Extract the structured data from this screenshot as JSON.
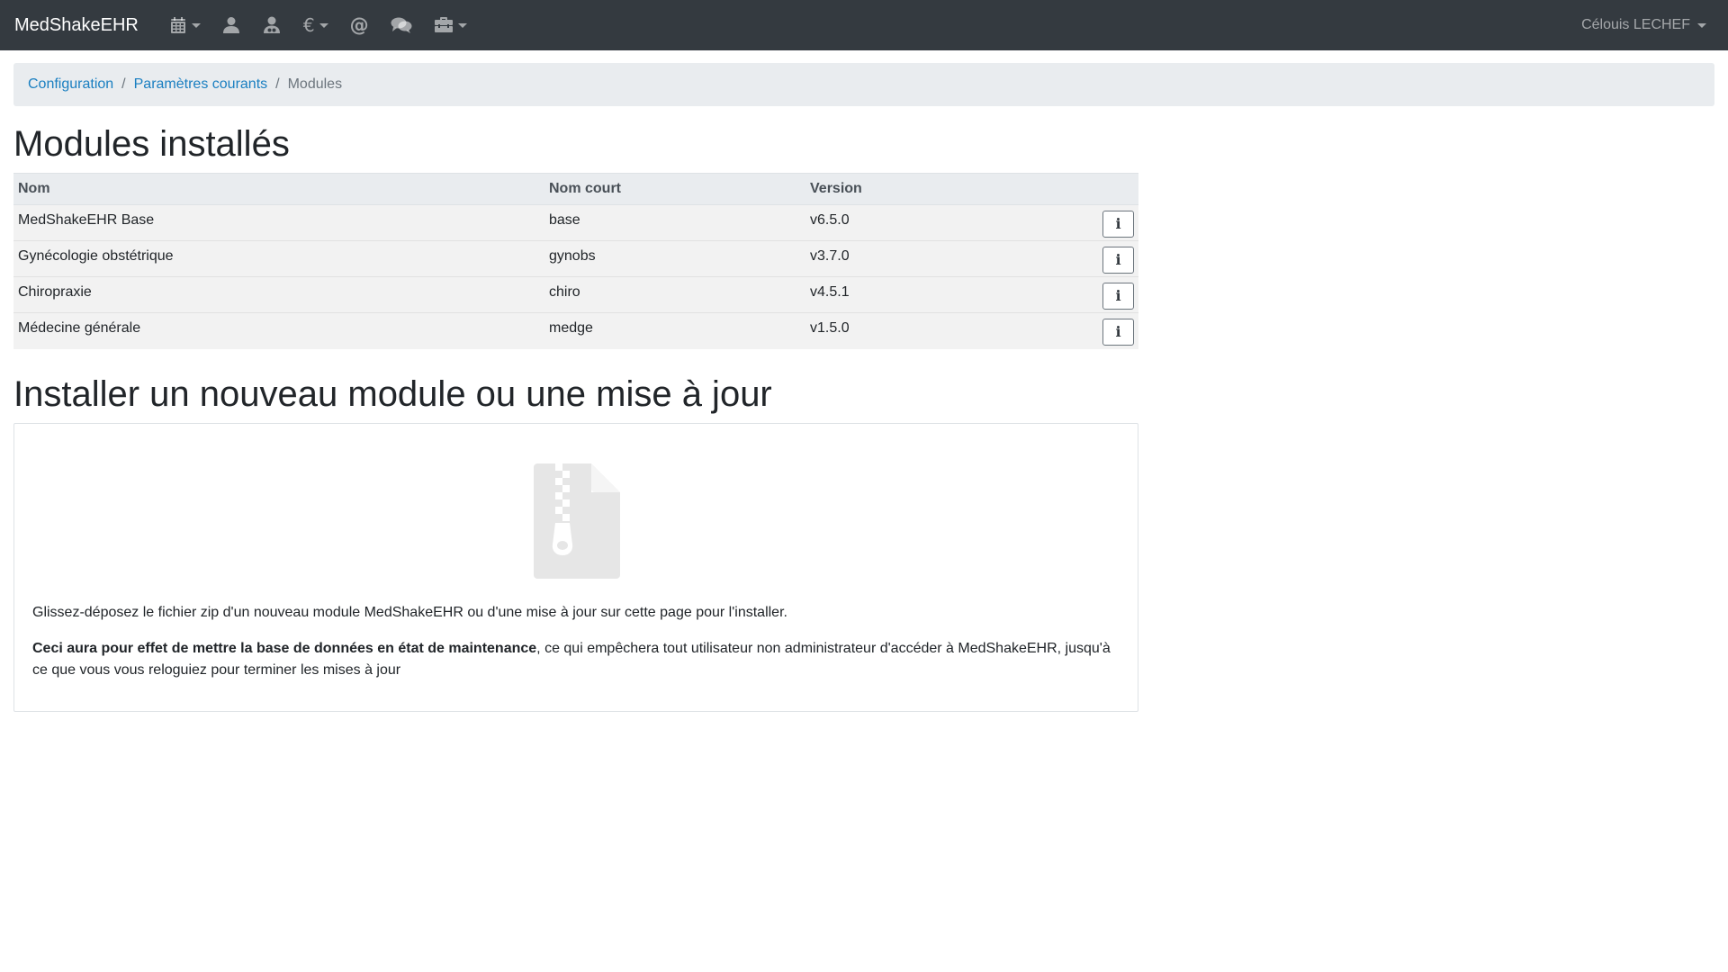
{
  "navbar": {
    "brand": "MedShakeEHR",
    "items": [
      {
        "icon": "calendar-icon",
        "has_dropdown": true
      },
      {
        "icon": "user-icon",
        "has_dropdown": false
      },
      {
        "icon": "user-search-icon",
        "has_dropdown": false
      },
      {
        "icon": "euro-icon",
        "glyph": "€",
        "has_dropdown": true
      },
      {
        "icon": "at-icon",
        "glyph": "@",
        "has_dropdown": false
      },
      {
        "icon": "comments-icon",
        "has_dropdown": false
      },
      {
        "icon": "toolbox-icon",
        "has_dropdown": true
      }
    ],
    "user": "Célouis LECHEF"
  },
  "breadcrumb": {
    "items": [
      "Configuration",
      "Paramètres courants"
    ],
    "active": "Modules"
  },
  "installed": {
    "title": "Modules installés",
    "columns": [
      "Nom",
      "Nom court",
      "Version"
    ],
    "rows": [
      {
        "name": "MedShakeEHR Base",
        "short": "base",
        "version": "v6.5.0"
      },
      {
        "name": "Gynécologie obstétrique",
        "short": "gynobs",
        "version": "v3.7.0"
      },
      {
        "name": "Chiropraxie",
        "short": "chiro",
        "version": "v4.5.1"
      },
      {
        "name": "Médecine générale",
        "short": "medge",
        "version": "v1.5.0"
      }
    ],
    "info_label": "i"
  },
  "install": {
    "title": "Installer un nouveau module ou une mise à jour",
    "instruction": "Glissez-déposez le fichier zip d'un nouveau module MedShakeEHR ou d'une mise à jour sur cette page pour l'installer.",
    "warning_bold": "Ceci aura pour effet de mettre la base de données en état de maintenance",
    "warning_rest": ", ce qui empêchera tout utilisateur non administrateur d'accéder à MedShakeEHR, jusqu'à ce que vous vous reloguiez pour terminer les mises à jour",
    "icon": "file-zip-icon"
  }
}
